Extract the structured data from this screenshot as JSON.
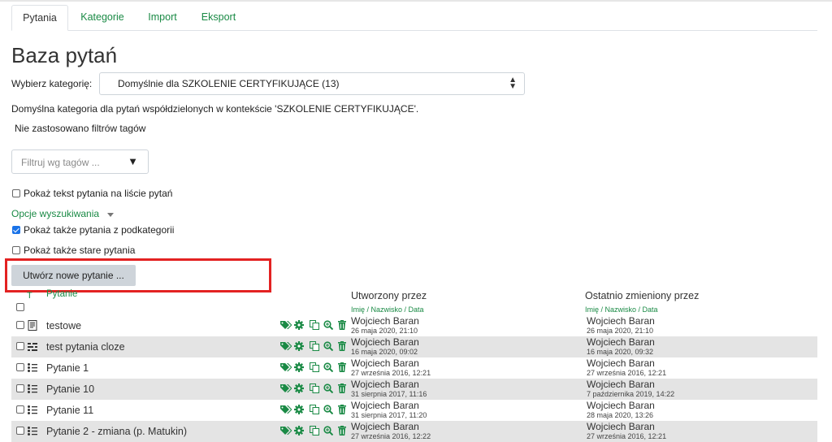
{
  "tabs": [
    {
      "label": "Pytania",
      "active": true
    },
    {
      "label": "Kategorie",
      "active": false
    },
    {
      "label": "Import",
      "active": false
    },
    {
      "label": "Eksport",
      "active": false
    }
  ],
  "page_title": "Baza pytań",
  "category": {
    "label": "Wybierz kategorię:",
    "selected": "Domyślnie dla SZKOLENIE CERTYFIKUJĄCE (13)"
  },
  "category_info": "Domyślna kategoria dla pytań współdzielonych w kontekście 'SZKOLENIE CERTYFIKUJĄCE'.",
  "tag_filter": {
    "status": "Nie zastosowano filtrów tagów",
    "placeholder": "Filtruj wg tagów ..."
  },
  "options": {
    "show_text_label": "Pokaż tekst pytania na liście pytań",
    "show_text_checked": false,
    "search_options_label": "Opcje wyszukiwania",
    "subcategories_label": "Pokaż także pytania z podkategorii",
    "subcategories_checked": true,
    "old_questions_label": "Pokaż także stare pytania",
    "old_questions_checked": false
  },
  "create_button": "Utwórz nowe pytanie ...",
  "table": {
    "col_t": "T",
    "col_question": "Pytanie",
    "col_created": "Utworzony przez",
    "col_modified": "Ostatnio zmieniony przez",
    "sort_created": "Imię / Nazwisko / Data",
    "sort_modified": "Imię / Nazwisko / Data",
    "rows": [
      {
        "type": "essay",
        "name": "testowe",
        "created_by": "Wojciech Baran",
        "created_at": "26 maja 2020, 21:10",
        "modified_by": "Wojciech Baran",
        "modified_at": "26 maja 2020, 21:10",
        "shaded": false
      },
      {
        "type": "cloze",
        "name": "test pytania cloze",
        "created_by": "Wojciech Baran",
        "created_at": "16 maja 2020, 09:02",
        "modified_by": "Wojciech Baran",
        "modified_at": "16 maja 2020, 09:32",
        "shaded": true
      },
      {
        "type": "multichoice",
        "name": "Pytanie 1",
        "created_by": "Wojciech Baran",
        "created_at": "27 września 2016, 12:21",
        "modified_by": "Wojciech Baran",
        "modified_at": "27 września 2016, 12:21",
        "shaded": false
      },
      {
        "type": "multichoice",
        "name": "Pytanie 10",
        "created_by": "Wojciech Baran",
        "created_at": "31 sierpnia 2017, 11:16",
        "modified_by": "Wojciech Baran",
        "modified_at": "7 października 2019, 14:22",
        "shaded": true
      },
      {
        "type": "multichoice",
        "name": "Pytanie 11",
        "created_by": "Wojciech Baran",
        "created_at": "31 sierpnia 2017, 11:20",
        "modified_by": "Wojciech Baran",
        "modified_at": "28 maja 2020, 13:26",
        "shaded": false
      },
      {
        "type": "multichoice",
        "name": "Pytanie 2 - zmiana (p. Matukin)",
        "created_by": "Wojciech Baran",
        "created_at": "27 września 2016, 12:22",
        "modified_by": "Wojciech Baran",
        "modified_at": "27 września 2016, 12:21",
        "shaded": true
      }
    ]
  },
  "colors": {
    "accent": "#1a8a45",
    "highlight_box": "#e32222",
    "row_shade": "#e4e4e4",
    "button": "#ced4da"
  }
}
